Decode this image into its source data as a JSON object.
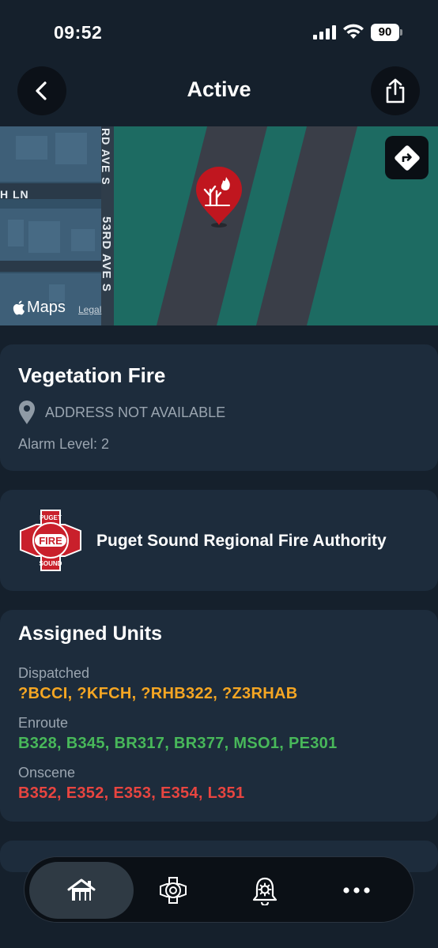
{
  "status_bar": {
    "time": "09:52",
    "battery": "90"
  },
  "nav": {
    "title": "Active"
  },
  "map": {
    "street_labels": [
      "RD AVE S",
      "53RD AVE S",
      "H LN"
    ],
    "brand": "Maps",
    "legal": "Legal"
  },
  "incident": {
    "title": "Vegetation Fire",
    "address": "ADDRESS NOT AVAILABLE",
    "alarm_level": "Alarm Level: 2"
  },
  "agency": {
    "name": "Puget Sound Regional Fire Authority",
    "logo_text_top": "PUGET",
    "logo_text_mid": "FIRE",
    "logo_text_bottom": "SOUND"
  },
  "units": {
    "title": "Assigned Units",
    "dispatched_label": "Dispatched",
    "dispatched": "?BCCI, ?KFCH, ?RHB322, ?Z3RHAB",
    "enroute_label": "Enroute",
    "enroute": "B328, B345, BR317, BR377, MSO1, PE301",
    "onscene_label": "Onscene",
    "onscene": "B352, E352, E353, E354, L351"
  },
  "colors": {
    "dispatched": "#f5a623",
    "enroute": "#48b85a",
    "onscene": "#e84540",
    "card": "#1d2c3c",
    "background": "#15202c"
  },
  "tabs": {
    "home_icon": "home-icon",
    "agencies_icon": "fire-badge-icon",
    "alerts_icon": "bell-gear-icon",
    "more_icon": "ellipsis-icon",
    "selected": "home"
  }
}
